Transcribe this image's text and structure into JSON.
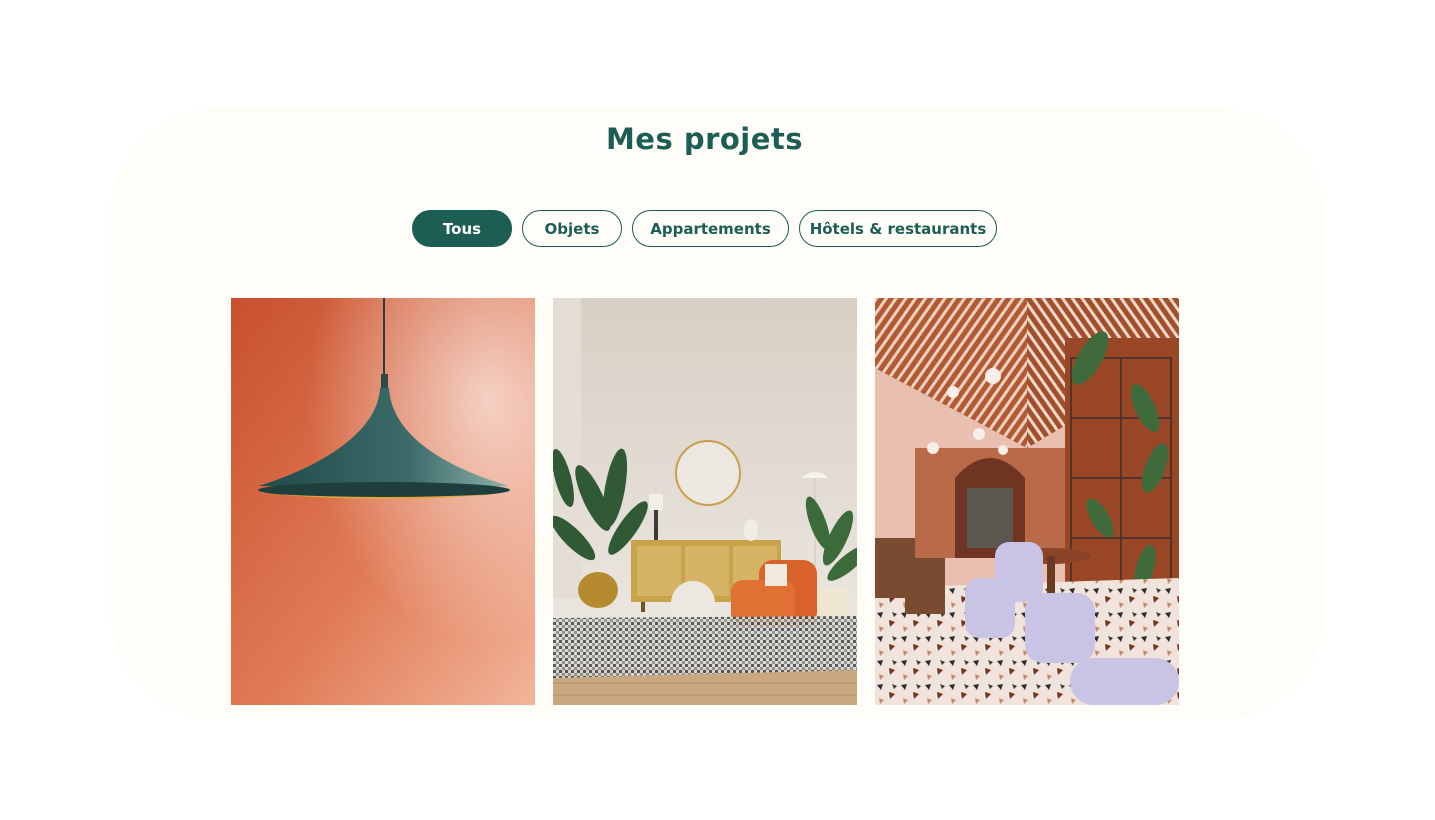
{
  "section": {
    "title": "Mes projets"
  },
  "filters": {
    "items": [
      {
        "label": "Tous",
        "active": true
      },
      {
        "label": "Objets",
        "active": false
      },
      {
        "label": "Appartements",
        "active": false
      },
      {
        "label": "Hôtels & restaurants",
        "active": false
      }
    ]
  },
  "colors": {
    "brand": "#1c5e53",
    "section_bg": "#fffdf7"
  },
  "gallery": {
    "images": [
      {
        "subject": "pendant-lamp-photo"
      },
      {
        "subject": "living-room-photo"
      },
      {
        "subject": "restaurant-interior-photo"
      }
    ]
  }
}
